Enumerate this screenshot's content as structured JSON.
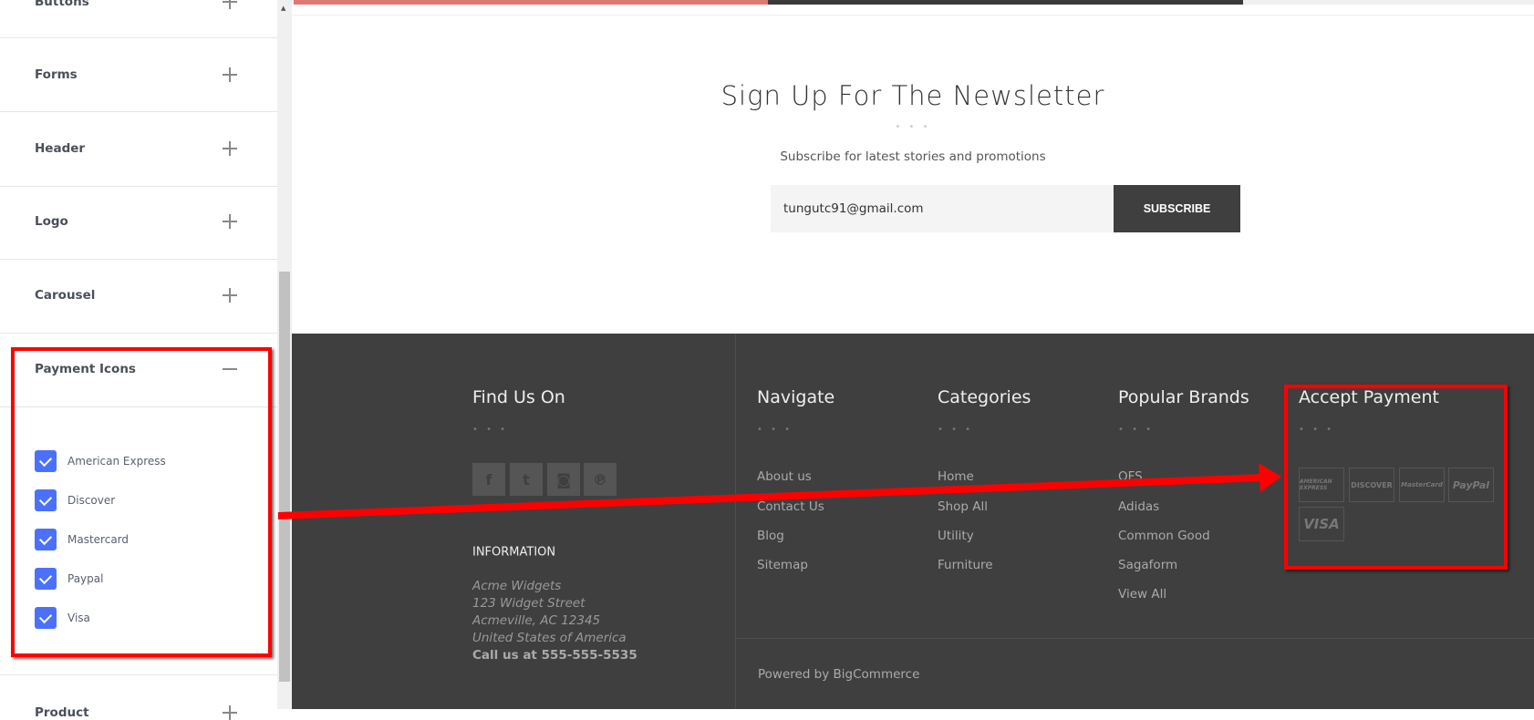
{
  "sidebar": {
    "sections": [
      {
        "label": "Buttons",
        "state": "collapsed"
      },
      {
        "label": "Forms",
        "state": "collapsed"
      },
      {
        "label": "Header",
        "state": "collapsed"
      },
      {
        "label": "Logo",
        "state": "collapsed"
      },
      {
        "label": "Carousel",
        "state": "collapsed"
      },
      {
        "label": "Payment Icons",
        "state": "expanded"
      },
      {
        "label": "Product",
        "state": "collapsed"
      }
    ],
    "payment_options": [
      {
        "label": "American Express",
        "checked": true
      },
      {
        "label": "Discover",
        "checked": true
      },
      {
        "label": "Mastercard",
        "checked": true
      },
      {
        "label": "Paypal",
        "checked": true
      },
      {
        "label": "Visa",
        "checked": true
      }
    ],
    "checkbox_color": "#4b71fc"
  },
  "newsletter": {
    "title": "Sign Up For The Newsletter",
    "dots": "• • •",
    "subtitle": "Subscribe for latest stories and promotions",
    "email_value": "tungutc91@gmail.com",
    "button": "SUBSCRIBE"
  },
  "footer": {
    "find_us": {
      "title": "Find Us On",
      "social": [
        "facebook-icon",
        "twitter-icon",
        "instagram-icon",
        "pinterest-icon"
      ]
    },
    "information": {
      "title": "INFORMATION",
      "lines": [
        "Acme Widgets",
        "123 Widget Street",
        "Acmeville, AC 12345",
        "United States of America"
      ],
      "phone": "Call us at 555-555-5535"
    },
    "navigate": {
      "title": "Navigate",
      "links": [
        "About us",
        "Contact Us",
        "Blog",
        "Sitemap"
      ]
    },
    "categories": {
      "title": "Categories",
      "links": [
        "Home",
        "Shop All",
        "Utility",
        "Furniture"
      ]
    },
    "brands": {
      "title": "Popular Brands",
      "links": [
        "OFS",
        "Adidas",
        "Common Good",
        "Sagaform",
        "View All"
      ]
    },
    "payment": {
      "title": "Accept Payment",
      "icons": [
        "AMERICAN EXPRESS",
        "DISCOVER",
        "MasterCard",
        "PayPal",
        "VISA"
      ]
    },
    "powered": "Powered by BigCommerce"
  },
  "colors": {
    "footer_bg": "#3f3f3f",
    "top_bar": [
      "#e07776",
      "#3a3a3a",
      "#f0f0f0"
    ],
    "annotation": "#ff0000"
  }
}
